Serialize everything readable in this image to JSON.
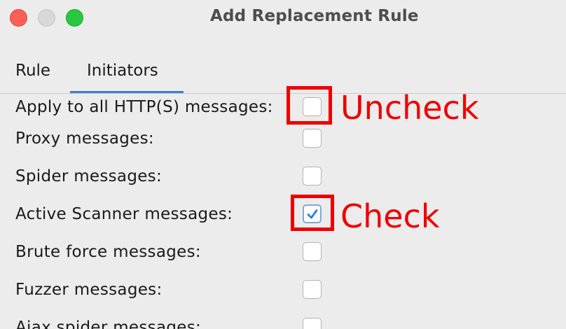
{
  "window": {
    "title": "Add Replacement Rule"
  },
  "tabs": [
    {
      "label": "Rule",
      "selected": false
    },
    {
      "label": "Initiators",
      "selected": true
    }
  ],
  "rows": [
    {
      "label": "Apply to all HTTP(S) messages:",
      "checked": false
    },
    {
      "label": "Proxy messages:",
      "checked": false
    },
    {
      "label": "Spider messages:",
      "checked": false
    },
    {
      "label": "Active Scanner messages:",
      "checked": true
    },
    {
      "label": "Brute force messages:",
      "checked": false
    },
    {
      "label": "Fuzzer messages:",
      "checked": false
    },
    {
      "label": "Ajax spider messages:",
      "checked": false
    }
  ],
  "annotations": {
    "uncheck": "Uncheck",
    "check": "Check"
  },
  "colors": {
    "annotation": "#ee0000",
    "tab_accent": "#3d7fcf",
    "checkmark": "#2f7de1"
  },
  "icons": {
    "checkmark": "checkmark-icon"
  }
}
